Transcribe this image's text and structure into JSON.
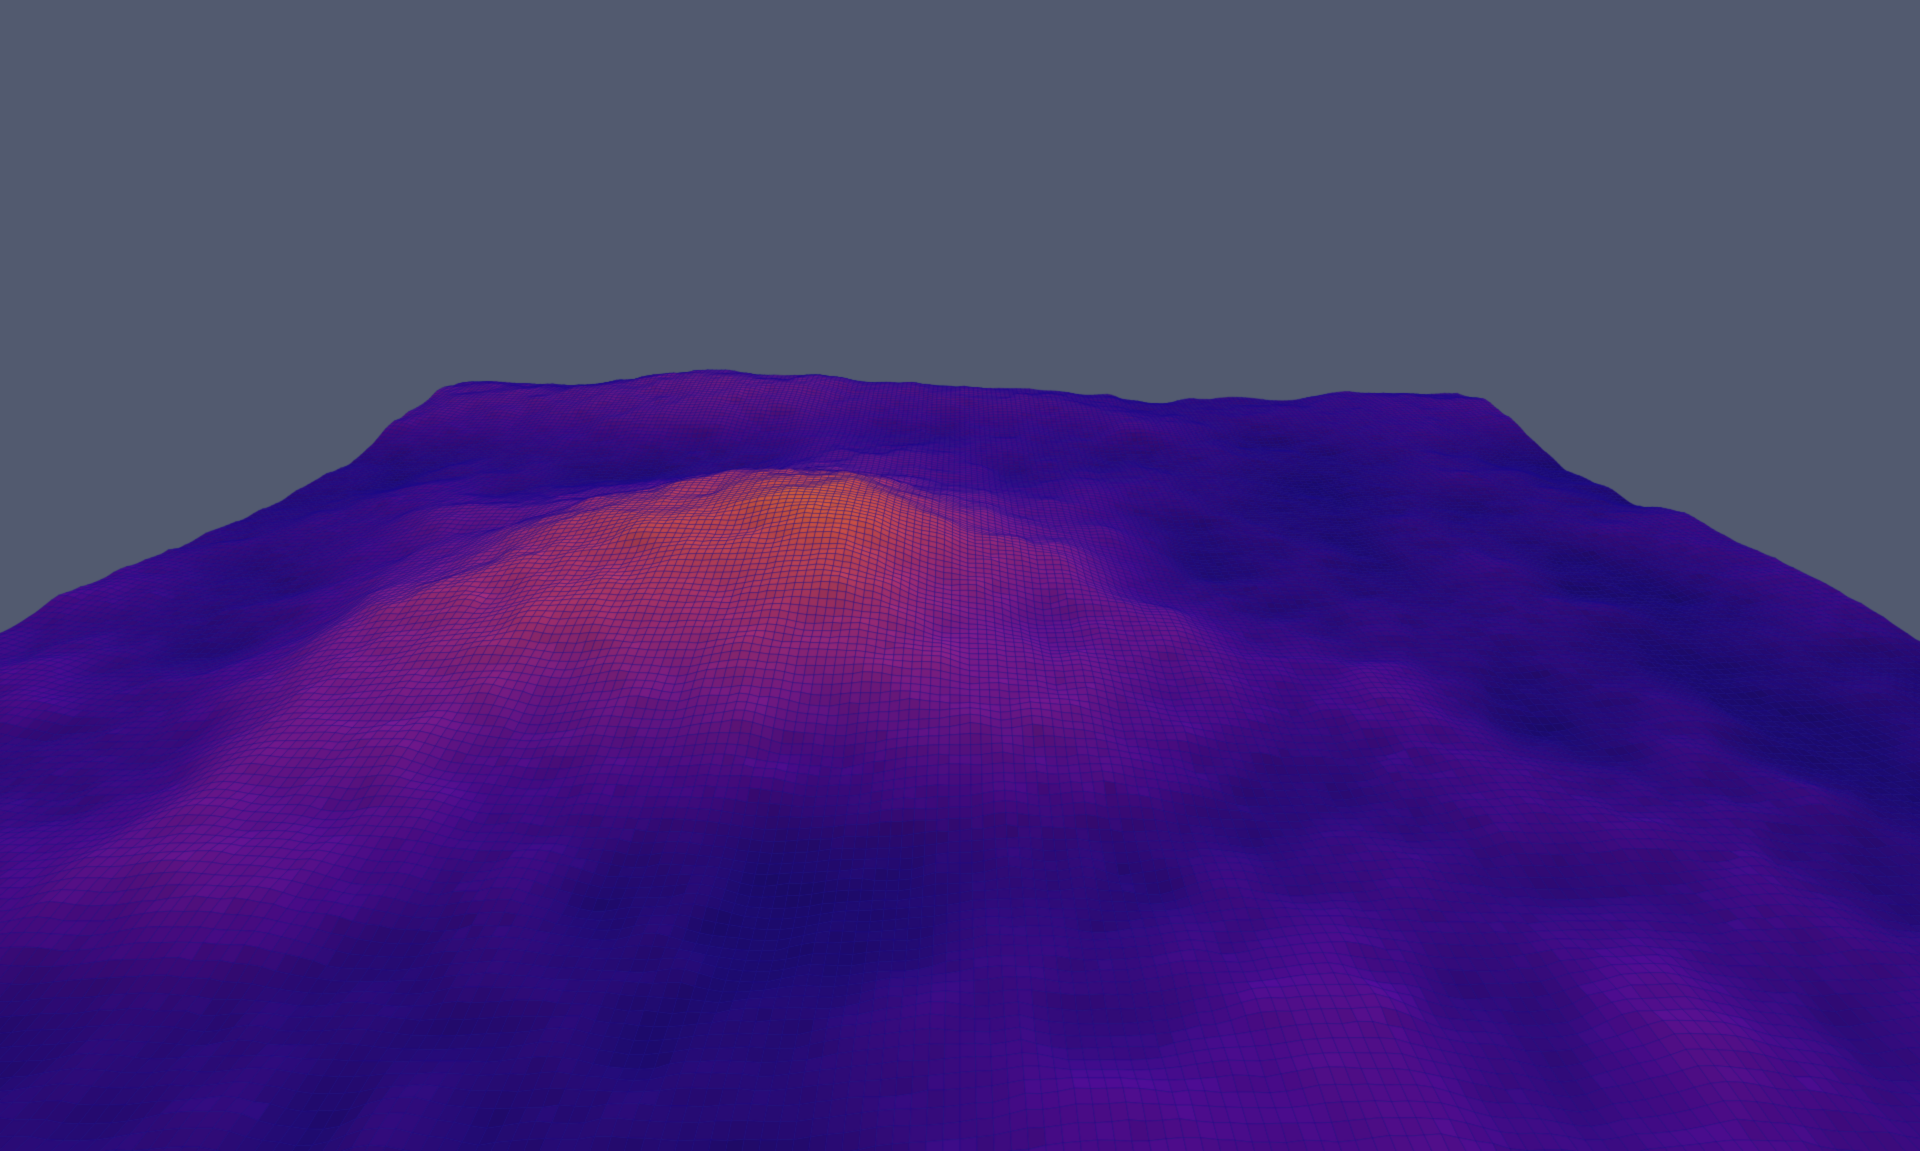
{
  "scene": {
    "background_color": "#525a6f",
    "wireframe_color": "#1a0a8c",
    "colormap": [
      "#1d0b6e",
      "#4a0c8a",
      "#7a1c8c",
      "#a8326f",
      "#cf4f4a",
      "#ea7a26",
      "#f5b21c",
      "#f2e26e"
    ]
  }
}
